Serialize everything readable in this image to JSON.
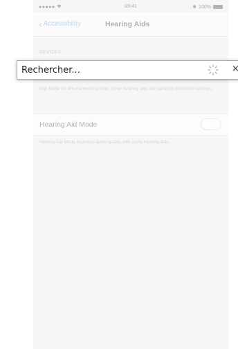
{
  "status_bar": {
    "signal": "●●●●● ",
    "wifi_icon": "wifi-icon",
    "time": "09:41",
    "bluetooth_icon": "bluetooth-icon",
    "battery_percent": "100%"
  },
  "nav": {
    "back_label": "Accessibility",
    "title": "Hearing Aids"
  },
  "devices": {
    "header": "DEVICES",
    "footer": "Pair Made for iPhone Hearing Aids. Other hearing aids are paired in Bluetooth settings."
  },
  "hearing_aid_mode": {
    "label": "Hearing Aid Mode",
    "enabled": false,
    "footer": "Hearing Aid Mode improves audio quality with some hearing aids."
  },
  "search_overlay": {
    "text": "Rechercher...",
    "close_symbol": "×"
  }
}
